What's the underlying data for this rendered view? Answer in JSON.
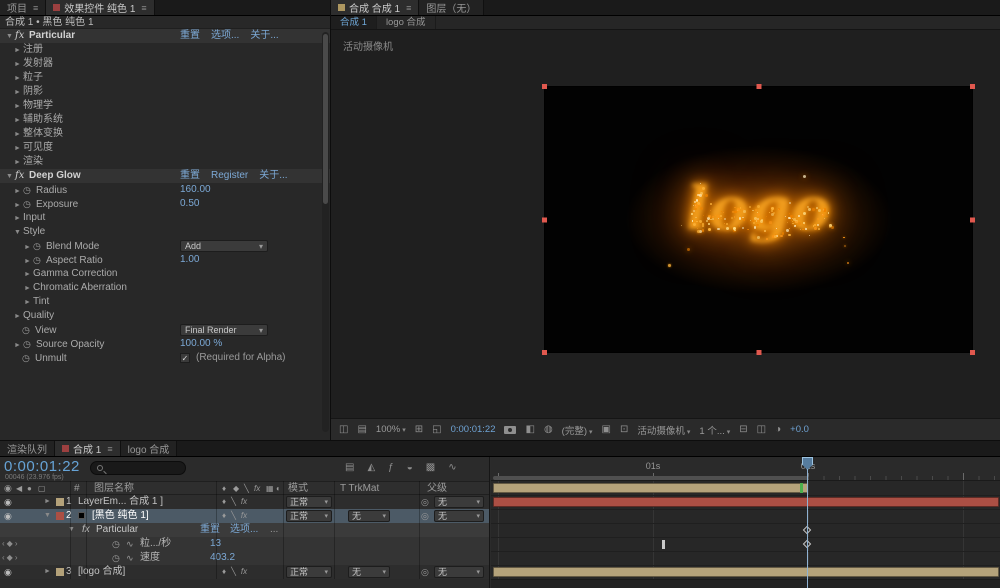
{
  "icons": {
    "menu": "≡",
    "twirl_open": "▼",
    "twirl_closed": "►",
    "stopwatch": "◷",
    "chevron": "▾",
    "check": "✓",
    "eye": "◉",
    "audio": "◀",
    "solo": "●",
    "lock": "▢",
    "diamond": "♦",
    "quality_slash": "╲",
    "fx": "fx",
    "frame_blend": "▦",
    "motion_blur": "◐",
    "adjustment": "◑",
    "pick": "◎",
    "kf_prev": "‹",
    "kf_dot": "◆",
    "kf_next": "›",
    "graph": "∿",
    "grid": "⊞",
    "monitor": "◫",
    "region": "◱",
    "snapshot_after": "◧",
    "channels": "◍",
    "roi": "▣",
    "transparency": "⊡",
    "layout": "⊟",
    "flowchart": "▤",
    "draft": "◭",
    "fn": "ƒ",
    "blur_half": "◒",
    "grid_dense": "▩",
    "wave": "∿"
  },
  "effect_controls": {
    "tab_project": "项目",
    "tab_effects": "效果控件 纯色 1",
    "breadcrumb": "合成 1 • 黑色 纯色 1",
    "particular": {
      "name": "Particular",
      "reset": "重置",
      "options": "选项...",
      "about": "关于...",
      "groups": [
        "注册",
        "发射器",
        "粒子",
        "阴影",
        "物理学",
        "辅助系统",
        "整体变换",
        "可见度",
        "渲染"
      ]
    },
    "deep_glow": {
      "name": "Deep Glow",
      "reset": "重置",
      "register": "Register",
      "about": "关于...",
      "radius": {
        "label": "Radius",
        "value": "160.00"
      },
      "exposure": {
        "label": "Exposure",
        "value": "0.50"
      },
      "input": "Input",
      "style": "Style",
      "blend_mode": {
        "label": "Blend Mode",
        "value": "Add"
      },
      "aspect_ratio": {
        "label": "Aspect Ratio",
        "value": "1.00"
      },
      "gamma": "Gamma Correction",
      "chromatic": "Chromatic Aberration",
      "tint": "Tint",
      "quality": "Quality",
      "view": {
        "label": "View",
        "value": "Final Render"
      },
      "source_opacity": {
        "label": "Source Opacity",
        "value": "100.00 %"
      },
      "unmult": {
        "label": "Unmult",
        "note": "(Required for Alpha)"
      }
    }
  },
  "comp_panel": {
    "tab_comp": "合成 合成 1",
    "tab_layer": "图层（无）",
    "subtab_comp1": "合成 1",
    "subtab_logo": "logo 合成",
    "camera_label": "活动摄像机",
    "logo_text": "logo",
    "toolbar": {
      "zoom": "100%",
      "timecode": "0:00:01:22",
      "resolution": "(完整)",
      "camera_view": "活动摄像机",
      "view_count": "1 个...",
      "exposure": "+0.0"
    }
  },
  "timeline": {
    "tab_render_queue": "渲染队列",
    "tab_comp1": "合成 1",
    "tab_logo": "logo 合成",
    "timecode": "0:00:01:22",
    "frame_info": "00046 (23.976 fps)",
    "headers": {
      "index": "#",
      "name": "图层名称",
      "mode": "模式",
      "trkmat": "T TrkMat",
      "parent": "父级"
    },
    "ruler": {
      "t1": "01s",
      "t2": "02s"
    },
    "rows": [
      {
        "num": "1",
        "name": "LayerEm... 合成 1 ]",
        "mode": "正常",
        "parent": "无"
      },
      {
        "num": "2",
        "name": "[黑色 纯色 1]",
        "mode": "正常",
        "trkmat": "无",
        "parent": "无"
      },
      {
        "num": "3",
        "name": "[logo 合成]",
        "mode": "正常",
        "trkmat": "无",
        "parent": "无"
      }
    ],
    "effect": {
      "name": "Particular",
      "reset": "重置",
      "options": "选项...",
      "more": "...",
      "prop1": {
        "label": "粒.../秒",
        "value": "13"
      },
      "prop2": {
        "label": "速度",
        "value": "403.2"
      }
    }
  }
}
